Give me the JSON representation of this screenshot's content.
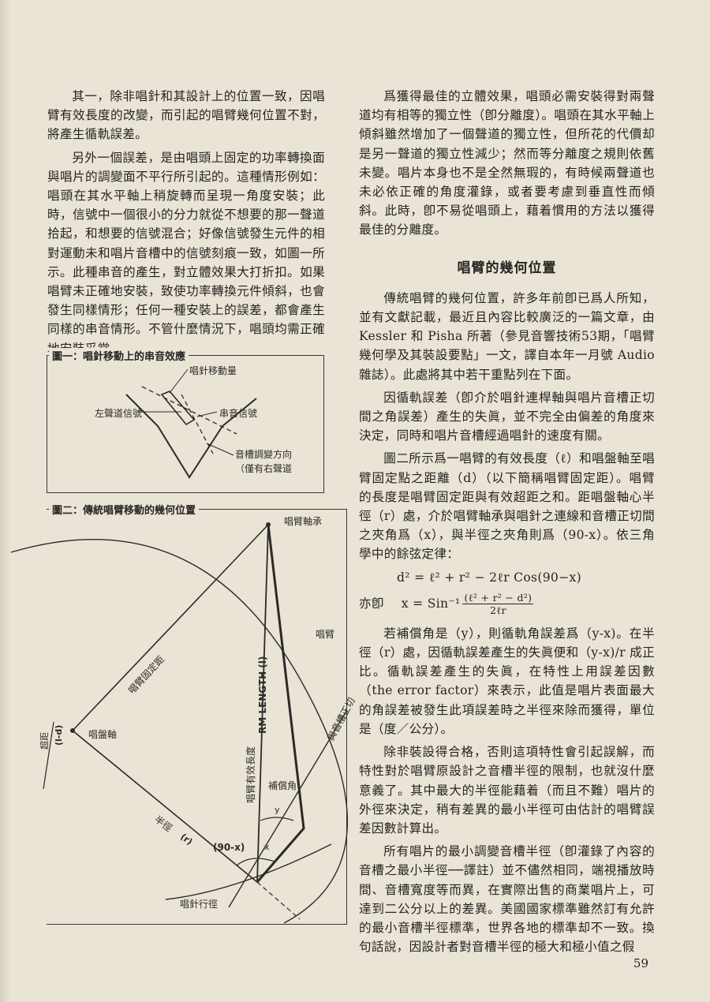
{
  "left_column": {
    "paragraphs": [
      "其一，除非唱針和其設計上的位置一致，因唱臂有效長度的改變，而引起的唱臂幾何位置不對，將產生循軌誤差。",
      "另外一個誤差，是由唱頭上固定的功率轉換面與唱片的調變面不平行所引起的。這種情形例如：唱頭在其水平軸上稍旋轉而呈現一角度安裝；此時，信號中一個很小的分力就從不想要的那一聲道拾起，和想要的信號混合；好像信號發生元件的相對運動未和唱片音槽中的信號刻痕一致，如圖一所示。此種串音的產生，對立體效果大打折扣。如果唱臂未正確地安裝，致使功率轉換元件傾斜，也會發生同樣情形；任何一種安裝上的誤差，都會產生同樣的串音情形。不管什麼情況下，唱頭均需正確地安裝妥當。"
    ]
  },
  "figure1": {
    "title": "圖一：唱針移動上的串音效應",
    "labels": {
      "stylus_movement": "唱針移動量",
      "left_signal": "左聲道信號",
      "crosstalk": "串音信號",
      "groove_direction_1": "音槽調變方向",
      "groove_direction_2": "（僅有右聲道"
    }
  },
  "figure2": {
    "title": "圖二：傳統唱臂移動的幾何位置",
    "labels": {
      "arm_bearing": "唱臂軸承",
      "arm": "唱臂",
      "mounting_distance": "唱臂固定距",
      "effective_length": "唱臂有效長度",
      "rm_length": "RM LENGTH (l)",
      "tangent": "與音槽正切",
      "overhang": "超距",
      "overhang_value": "(l-d)",
      "spindle": "唱盤軸",
      "offset_angle": "補償角",
      "y": "y",
      "x": "x",
      "radius": "半徑",
      "r": "(r)",
      "angle": "(90-x)",
      "stylus_path": "唱針行徑"
    }
  },
  "right_column": {
    "para1": "爲獲得最佳的立體效果，唱頭必需安裝得對兩聲道均有相等的獨立性（卽分離度）。唱頭在其水平軸上傾斜雖然增加了一個聲道的獨立性，但所花的代價却是另一聲道的獨立性減少；然而等分離度之規則依舊未變。唱片本身也不是全然無瑕的，有時候兩聲道也未必依正確的角度灌錄，或者要考慮到垂直性而傾斜。此時，卽不易從唱頭上，藉着慣用的方法以獲得最佳的分離度。",
    "heading": "唱臂的幾何位置",
    "para2": "傳統唱臂的幾何位置，許多年前卽已爲人所知，並有文獻記載，最近且內容比較廣泛的一篇文章，由 Kessler 和 Pisha 所著（參見音響技術53期，「唱臂幾何學及其裝設要點」一文，譯自本年一月號 Audio 雜誌）。此處將其中若干重點列在下面。",
    "para3": "因循軌誤差（卽介於唱針連桿軸與唱片音槽正切間之角誤差）產生的失眞，並不完全由偏差的角度來決定，同時和唱片音槽經過唱針的速度有關。",
    "para4": "圖二所示爲一唱臂的有效長度（ℓ）和唱盤軸至唱臂固定點之距離（d）（以下簡稱唱臂固定距）。唱臂的長度是唱臂固定距與有效超距之和。距唱盤軸心半徑（r）處，介於唱臂軸承與唱針之連線和音槽正切間之夾角爲（x），與半徑之夾角則爲（90-x）。依三角學中的餘弦定律：",
    "formula1": "d² = ℓ² + r² − 2ℓr Cos(90−x)",
    "formula2_prefix": "亦卽",
    "formula2_lhs": "x = Sin⁻¹",
    "formula2_num": "(ℓ² + r² − d²)",
    "formula2_den": "2ℓr",
    "para5": "若補償角是（y），則循軌角誤差爲（y-x)。在半徑（r）處，因循軌誤差產生的失眞便和（y-x)/r 成正比。循軌誤差產生的失眞，在特性上用誤差因數（the error factor）來表示，此值是唱片表面最大的角誤差被發生此項誤差時之半徑來除而獲得，單位是（度／公分）。",
    "para6": "除非裝設得合格，否則這項特性會引起誤解，而特性對於唱臂原設計之音槽半徑的限制，也就沒什麼意義了。其中最大的半徑能藉着（而且不難）唱片的外徑來決定，稍有差異的最小半徑可由估計的唱臂誤差因數計算出。",
    "para7": "所有唱片的最小調變音槽半徑（卽灌錄了內容的音槽之最小半徑──譯註）並不儘然相同，端視播放時間、音槽寬度等而異，在實際出售的商業唱片上，可達到二公分以上的差異。美國國家標準雖然訂有允許的最小音槽半徑標準，世界各地的標準却不一致。換句話說，因設計者對音槽半徑的極大和極小值之假"
  },
  "page_number": "59"
}
